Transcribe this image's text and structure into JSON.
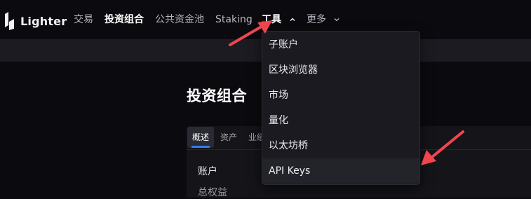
{
  "app": {
    "name": "Lighter"
  },
  "nav": {
    "items": [
      {
        "label": "交易"
      },
      {
        "label": "投资组合"
      },
      {
        "label": "公共资金池"
      },
      {
        "label": "Staking"
      },
      {
        "label": "工具"
      },
      {
        "label": "更多"
      }
    ]
  },
  "dropdown": {
    "items": [
      {
        "label": "子账户"
      },
      {
        "label": "区块浏览器"
      },
      {
        "label": "市场"
      },
      {
        "label": "量化"
      },
      {
        "label": "以太坊桥"
      },
      {
        "label": "API Keys"
      }
    ]
  },
  "page": {
    "title": "投资组合",
    "tabs": [
      {
        "label": "概述"
      },
      {
        "label": "资产"
      },
      {
        "label": "业绩"
      }
    ],
    "section_label": "账户",
    "section_sub": "总权益"
  },
  "colors": {
    "accent": "#2e7dff",
    "annotation_arrow": "#f0454f",
    "background": "#0b0b0f"
  }
}
